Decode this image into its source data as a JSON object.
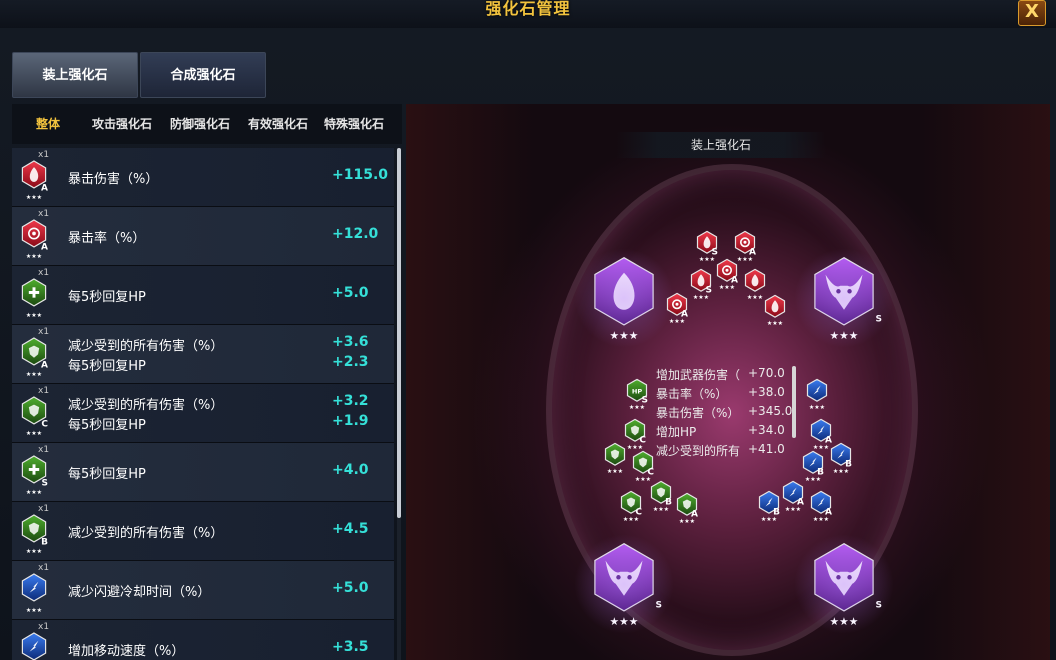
{
  "window": {
    "title": "强化石管理",
    "close_label": "X"
  },
  "tabs": [
    {
      "label": "装上强化石",
      "active": true
    },
    {
      "label": "合成强化石",
      "active": false
    }
  ],
  "subtabs": [
    "整体",
    "攻击强化石",
    "防御强化石",
    "有效强化石",
    "特殊强化石"
  ],
  "list": [
    {
      "qty": "x1",
      "gem": {
        "color": "red",
        "icon": "flame-icon",
        "grade": "A"
      },
      "lines": [
        {
          "stat": "暴击伤害（%）",
          "value": "+115.0"
        }
      ]
    },
    {
      "qty": "x1",
      "gem": {
        "color": "red",
        "icon": "aim-icon",
        "grade": "A"
      },
      "lines": [
        {
          "stat": "暴击率（%）",
          "value": "+12.0"
        }
      ]
    },
    {
      "qty": "x1",
      "gem": {
        "color": "green",
        "icon": "cross-icon",
        "grade": ""
      },
      "lines": [
        {
          "stat": "每5秒回复HP",
          "value": "+5.0"
        }
      ]
    },
    {
      "qty": "x1",
      "gem": {
        "color": "green",
        "icon": "shield-plus-icon",
        "grade": "A"
      },
      "lines": [
        {
          "stat": "减少受到的所有伤害（%）",
          "value": "+3.6"
        },
        {
          "stat": "每5秒回复HP",
          "value": "+2.3"
        }
      ]
    },
    {
      "qty": "x1",
      "gem": {
        "color": "green",
        "icon": "shield-plus-icon",
        "grade": "C"
      },
      "lines": [
        {
          "stat": "减少受到的所有伤害（%）",
          "value": "+3.2"
        },
        {
          "stat": "每5秒回复HP",
          "value": "+1.9"
        }
      ]
    },
    {
      "qty": "x1",
      "gem": {
        "color": "green",
        "icon": "cross-icon",
        "grade": "S"
      },
      "lines": [
        {
          "stat": "每5秒回复HP",
          "value": "+4.0"
        }
      ]
    },
    {
      "qty": "x1",
      "gem": {
        "color": "green",
        "icon": "shield-icon",
        "grade": "B"
      },
      "lines": [
        {
          "stat": "减少受到的所有伤害（%）",
          "value": "+4.5"
        }
      ]
    },
    {
      "qty": "x1",
      "gem": {
        "color": "blue",
        "icon": "dodge-icon",
        "grade": ""
      },
      "lines": [
        {
          "stat": "减少闪避冷却时间（%）",
          "value": "+5.0"
        }
      ]
    },
    {
      "qty": "x1",
      "gem": {
        "color": "blue",
        "icon": "speed-icon",
        "grade": ""
      },
      "lines": [
        {
          "stat": "增加移动速度（%）",
          "value": "+3.5"
        }
      ]
    }
  ],
  "panel": {
    "header": "装上强化石",
    "summary": [
      {
        "label": "增加武器伤害（",
        "value": "+70.0"
      },
      {
        "label": "暴击率（%）",
        "value": "+38.0"
      },
      {
        "label": "暴击伤害（%）",
        "value": "+345.0"
      },
      {
        "label": "增加HP",
        "value": "+34.0"
      },
      {
        "label": "减少受到的所有",
        "value": "+41.0"
      }
    ],
    "big_slots": [
      {
        "name": "big-gem-flame",
        "icon": "purple-flame-icon",
        "grade": ""
      },
      {
        "name": "big-gem-demon-top",
        "icon": "demon-mask-icon",
        "grade": "S"
      },
      {
        "name": "big-gem-demon-bottom-left",
        "icon": "demon-mask-icon",
        "grade": "S"
      },
      {
        "name": "big-gem-demon-bottom-right",
        "icon": "demon-mask-icon",
        "grade": "S"
      }
    ],
    "red_gems": [
      "S",
      "A",
      "S",
      "A",
      "",
      "A",
      "",
      ""
    ],
    "green_gems": [
      "S",
      "C",
      "",
      "C",
      "C",
      "B",
      "A",
      "B"
    ],
    "blue_gems": [
      "",
      "A",
      "B",
      "B",
      "A",
      "B",
      "A",
      ""
    ],
    "green_gem_text": "HP"
  },
  "colors": {
    "title": "#f2c33e",
    "value": "#35e0d8",
    "red_gem": "#c8162a",
    "green_gem": "#2f7a1e",
    "blue_gem": "#1746b8",
    "purple_gem": "#8a32c8"
  }
}
